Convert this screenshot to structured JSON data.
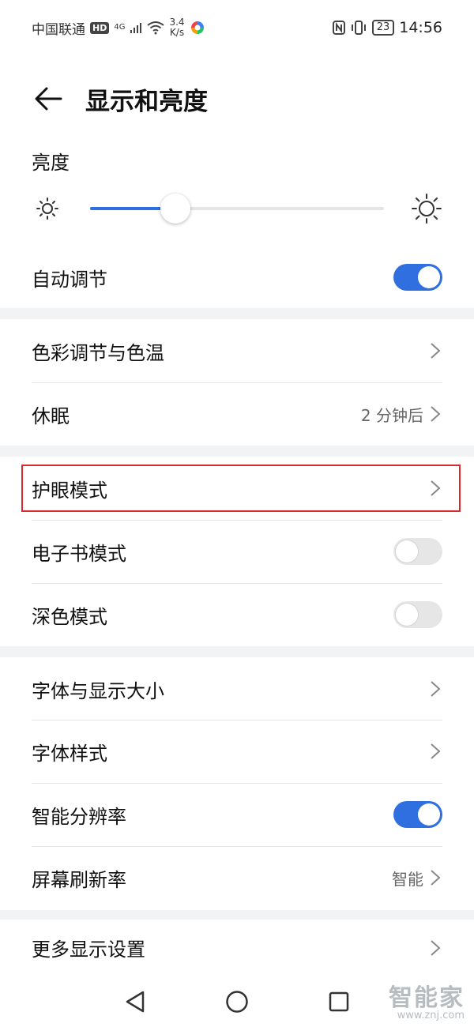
{
  "status_bar": {
    "carrier": "中国联通",
    "hd": "HD",
    "network": "4G",
    "speed_top": "3.4",
    "speed_bottom": "K/s",
    "battery": "23",
    "time": "14:56"
  },
  "header": {
    "title": "显示和亮度"
  },
  "brightness": {
    "title": "亮度",
    "level": 0.29
  },
  "auto_adjust": {
    "label": "自动调节",
    "on": true
  },
  "group2": {
    "color_temp": "色彩调节与色温",
    "sleep_label": "休眠",
    "sleep_value": "2 分钟后"
  },
  "group3": {
    "eye_comfort": "护眼模式",
    "ebook_label": "电子书模式",
    "ebook_on": false,
    "dark_label": "深色模式",
    "dark_on": false
  },
  "group4": {
    "font_size": "字体与显示大小",
    "font_style": "字体样式",
    "smart_res_label": "智能分辨率",
    "smart_res_on": true,
    "refresh_label": "屏幕刷新率",
    "refresh_value": "智能"
  },
  "group5": {
    "more": "更多显示设置"
  },
  "watermark": {
    "main": "智能家",
    "sub": "www.znj.com"
  },
  "colors": {
    "accent": "#2f6fe0",
    "highlight": "#e0272e"
  }
}
